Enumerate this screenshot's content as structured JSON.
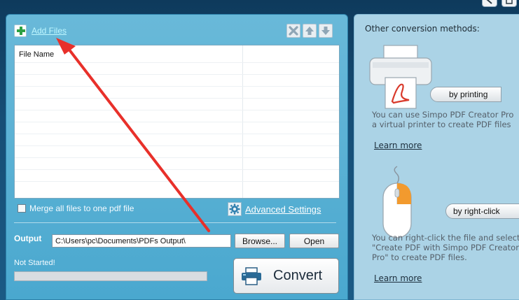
{
  "toolbar": {
    "add_files_label": "Add Files"
  },
  "file_list": {
    "column_name": "File Name"
  },
  "options": {
    "merge_label": "Merge all files to one pdf file",
    "advanced_label": "Advanced Settings"
  },
  "output": {
    "label": "Output",
    "path_value": "C:\\Users\\pc\\Documents\\PDFs Output\\",
    "browse_label": "Browse...",
    "open_label": "Open"
  },
  "status": {
    "text": "Not Started!",
    "progress": 0
  },
  "convert": {
    "label": "Convert"
  },
  "other_methods": {
    "heading": "Other conversion methods:",
    "printing": {
      "button_label": "by printing",
      "description_lines": [
        "You can use Simpo PDF Creator Pro",
        "a virtual printer to create PDF files"
      ],
      "link": "Learn more"
    },
    "right_click": {
      "button_label": "by right-click",
      "description_lines": [
        "You can right-click the file and select",
        "\"Create PDF with Simpo PDF Creator",
        "Pro\" to create PDF files."
      ],
      "link": "Learn more"
    }
  },
  "colors": {
    "panel_blue": "#4aa8cf",
    "right_panel": "#abd3e6",
    "link_cyan": "#bff7ff",
    "annotation_red": "#e8302a",
    "plus_green": "#2ea043"
  },
  "icons": [
    "plus-icon",
    "remove-icon",
    "move-up-icon",
    "move-down-icon",
    "gear-icon",
    "printer-icon",
    "pdf-icon",
    "mouse-icon",
    "minimize-icon",
    "close-icon"
  ]
}
